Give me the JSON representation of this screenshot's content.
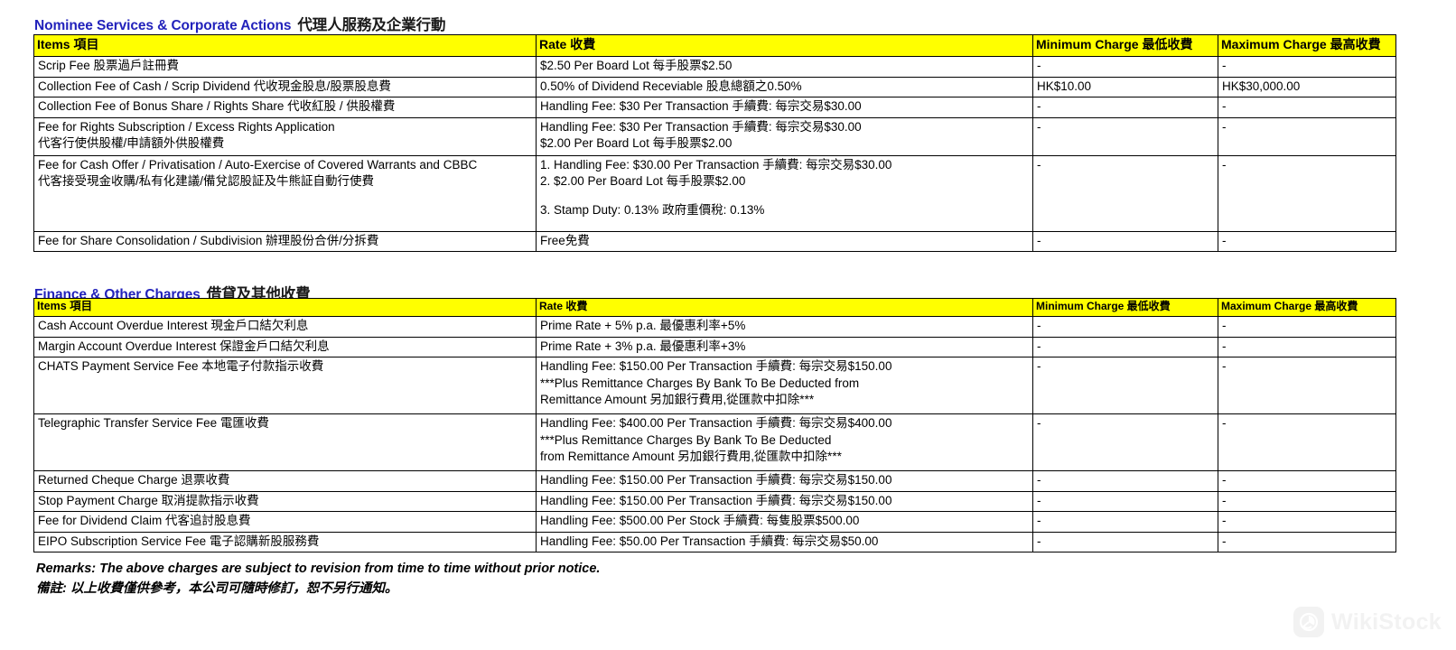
{
  "document": {
    "watermark": "WikiStock"
  },
  "sections": [
    {
      "id": "nominee",
      "title_en": "Nominee Services & Corporate Actions",
      "title_cn": "代理人服務及企業行動",
      "columns": {
        "items": "Items 項目",
        "rate": "Rate 收費",
        "min": "Minimum Charge 最低收費",
        "max": "Maximum Charge 最高收費"
      },
      "rows": [
        {
          "item_lines": [
            "Scrip Fee 股票過戶註冊費"
          ],
          "rate_lines": [
            "$2.50 Per Board Lot 每手股票$2.50"
          ],
          "min": "-",
          "max": "-"
        },
        {
          "item_lines": [
            "Collection Fee of Cash / Scrip Dividend 代收現金股息/股票股息費"
          ],
          "rate_lines": [
            "0.50% of Dividend Receviable 股息總額之0.50%"
          ],
          "min": "HK$10.00",
          "max": "HK$30,000.00"
        },
        {
          "item_lines": [
            "Collection Fee of Bonus Share / Rights Share 代收紅股 / 供股權費"
          ],
          "rate_lines": [
            "Handling Fee: $30 Per Transaction 手續費: 每宗交易$30.00"
          ],
          "min": "-",
          "max": "-"
        },
        {
          "item_lines": [
            "Fee for Rights Subscription / Excess Rights Application",
            "代客行使供股權/申請額外供股權費"
          ],
          "rate_lines": [
            "Handling Fee: $30 Per Transaction 手續費: 每宗交易$30.00",
            "$2.00 Per Board Lot 每手股票$2.00"
          ],
          "min": "-",
          "max": "-"
        },
        {
          "item_lines": [
            "Fee for Cash Offer / Privatisation / Auto-Exercise of Covered Warrants and CBBC",
            "代客接受現金收購/私有化建議/備兌認股証及牛熊証自動行使費"
          ],
          "rate_lines": [
            "1. Handling Fee: $30.00 Per Transaction 手續費: 每宗交易$30.00",
            "2. $2.00 Per Board Lot 每手股票$2.00",
            "",
            "3. Stamp Duty: 0.13% 政府重價稅: 0.13%"
          ],
          "min": "-",
          "max": "-"
        },
        {
          "item_lines": [
            "Fee for Share Consolidation / Subdivision 辦理股份合併/分拆費"
          ],
          "rate_lines": [
            "Free免費"
          ],
          "min": "-",
          "max": "-"
        }
      ]
    },
    {
      "id": "finance",
      "title_en": "Finance & Other Charges",
      "title_cn": "借貸及其他收費",
      "columns": {
        "items": "Items 項目",
        "rate": "Rate 收費",
        "min": "Minimum Charge 最低收費",
        "max": "Maximum Charge 最高收費"
      },
      "rows": [
        {
          "item_lines": [
            "Cash Account Overdue Interest 現金戶口結欠利息"
          ],
          "rate_lines": [
            "Prime Rate + 5% p.a. 最優惠利率+5%"
          ],
          "min": "-",
          "max": "-"
        },
        {
          "item_lines": [
            "Margin Account Overdue Interest 保證金戶口結欠利息"
          ],
          "rate_lines": [
            "Prime Rate + 3% p.a. 最優惠利率+3%"
          ],
          "min": "-",
          "max": "-"
        },
        {
          "item_lines": [
            "CHATS Payment Service Fee 本地電子付款指示收費"
          ],
          "rate_lines": [
            "Handling Fee: $150.00 Per Transaction 手續費: 每宗交易$150.00",
            "***Plus Remittance Charges By Bank To Be Deducted from",
            "Remittance Amount 另加銀行費用,從匯款中扣除***"
          ],
          "min": "-",
          "max": "-"
        },
        {
          "item_lines": [
            "Telegraphic Transfer Service Fee 電匯收費"
          ],
          "rate_lines": [
            "Handling Fee: $400.00 Per Transaction 手續費: 每宗交易$400.00",
            "***Plus Remittance Charges By Bank To Be Deducted",
            "from Remittance Amount 另加銀行費用,從匯款中扣除***"
          ],
          "min": "-",
          "max": "-"
        },
        {
          "item_lines": [
            "Returned Cheque Charge 退票收費"
          ],
          "rate_lines": [
            "Handling Fee: $150.00 Per Transaction 手續費: 每宗交易$150.00"
          ],
          "min": "-",
          "max": "-"
        },
        {
          "item_lines": [
            "Stop Payment Charge 取消提款指示收費"
          ],
          "rate_lines": [
            "Handling Fee: $150.00 Per Transaction 手續費: 每宗交易$150.00"
          ],
          "min": "-",
          "max": "-"
        },
        {
          "item_lines": [
            "Fee for Dividend Claim 代客追討股息費"
          ],
          "rate_lines": [
            "Handling Fee: $500.00 Per Stock 手續費: 每隻股票$500.00"
          ],
          "min": "-",
          "max": "-"
        },
        {
          "item_lines": [
            "EIPO Subscription Service Fee 電子認購新股服務費"
          ],
          "rate_lines": [
            "Handling Fee: $50.00 Per Transaction 手續費: 每宗交易$50.00"
          ],
          "min": "-",
          "max": "-"
        }
      ]
    }
  ],
  "remarks": {
    "line_en": "Remarks: The above charges are subject to revision from time to time without prior notice.",
    "line_cn": "備註: 以上收費僅供參考，本公司可隨時修訂，恕不另行通知。"
  }
}
